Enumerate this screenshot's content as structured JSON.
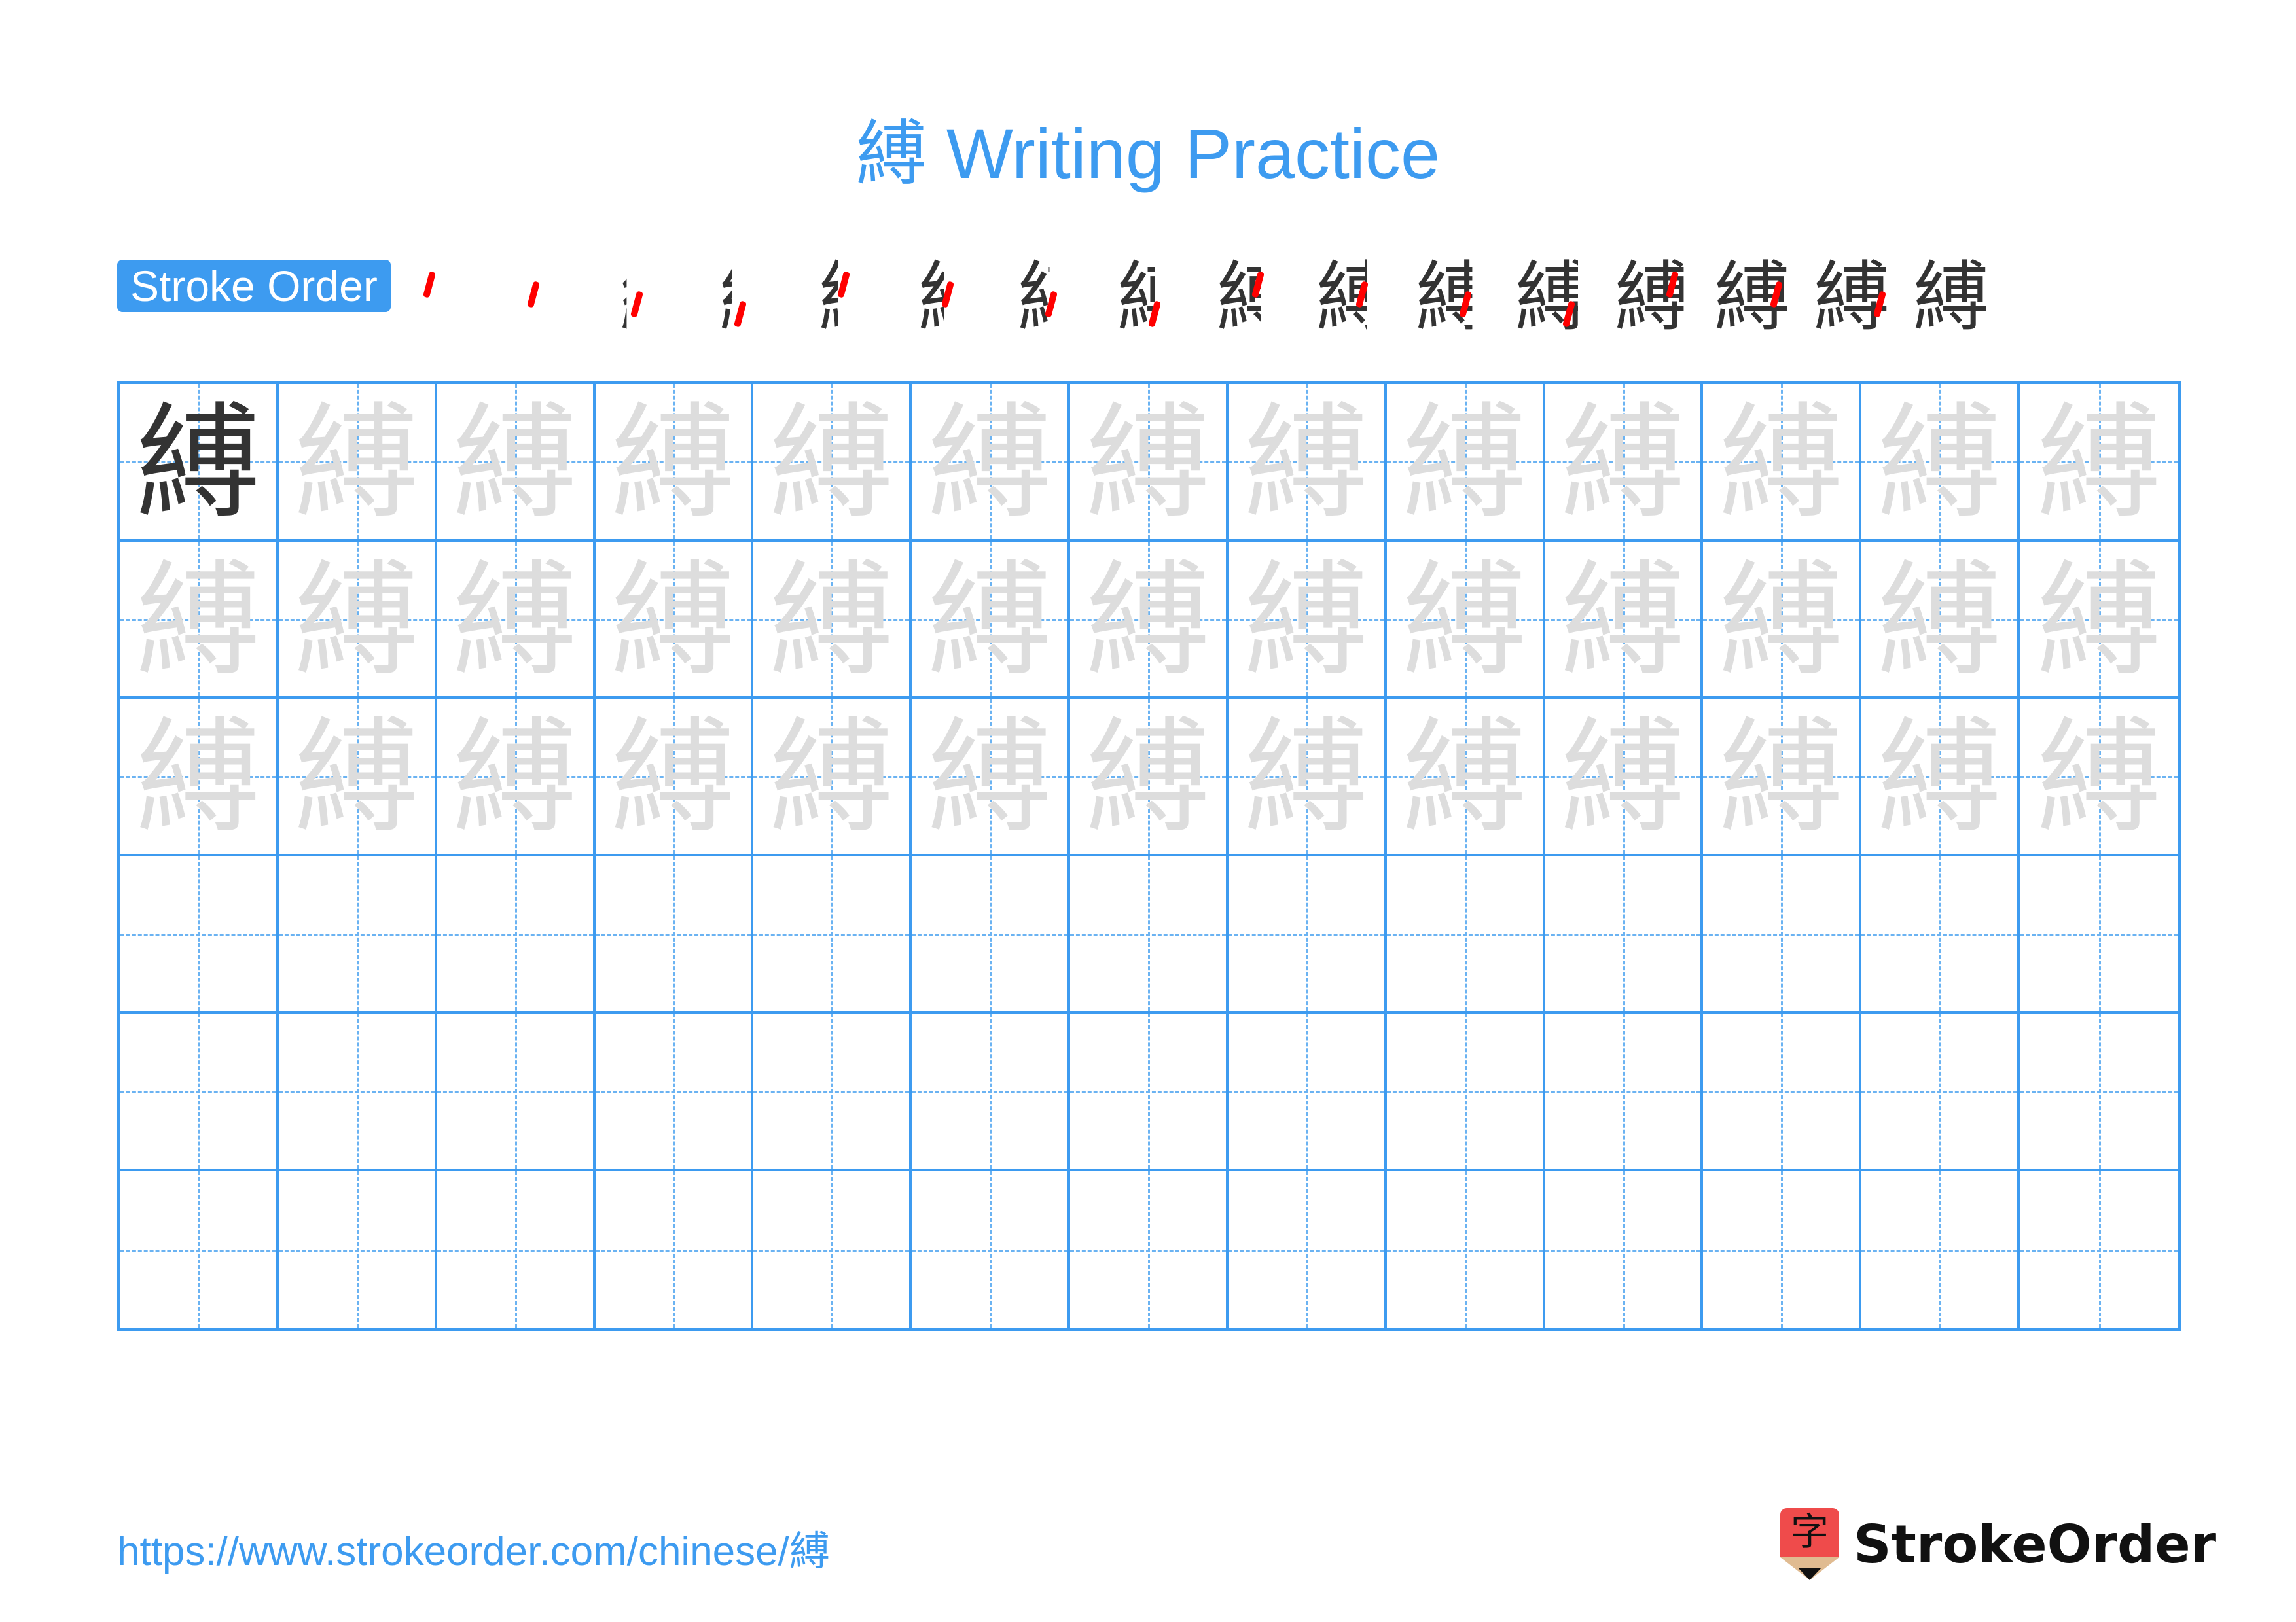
{
  "title": "縛 Writing Practice",
  "character": "縛",
  "stroke_order": {
    "label": "Stroke Order",
    "step_count": 16,
    "highlight_color": "#ff0000",
    "stroke_color": "#333333"
  },
  "grid": {
    "rows": 6,
    "cols": 13,
    "line_color": "#3d9bf0",
    "model_color": "#333333",
    "trace_color": "#dddddd",
    "rows_content": [
      "model+trace",
      "trace",
      "trace",
      "empty",
      "empty",
      "empty"
    ]
  },
  "footer": {
    "url": "https://www.strokeorder.com/chinese/縛",
    "logo_glyph": "字",
    "brand": "StrokeOrder"
  }
}
